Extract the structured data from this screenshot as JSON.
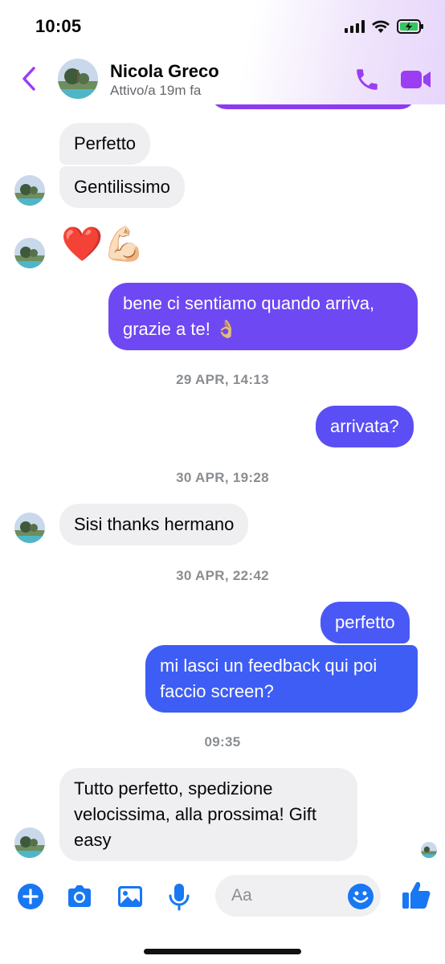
{
  "status_bar": {
    "time": "10:05"
  },
  "header": {
    "contact_name": "Nicola Greco",
    "contact_status": "Attivo/a 19m fa",
    "accent_color": "#9b3df2"
  },
  "messages": [
    {
      "type": "in",
      "text": "Perfetto"
    },
    {
      "type": "in",
      "text": "Gentilissimo"
    },
    {
      "type": "in_emoji",
      "text": "❤️💪🏻"
    },
    {
      "type": "out",
      "text": "bene ci sentiamo quando arriva, grazie a te! 👌🏼"
    },
    {
      "type": "timestamp",
      "text": "29 APR, 14:13"
    },
    {
      "type": "out",
      "text": "arrivata?"
    },
    {
      "type": "timestamp",
      "text": "30 APR, 19:28"
    },
    {
      "type": "in",
      "text": "Sisi thanks hermano"
    },
    {
      "type": "timestamp",
      "text": "30 APR, 22:42"
    },
    {
      "type": "out",
      "text": "perfetto"
    },
    {
      "type": "out",
      "text": "mi lasci un feedback qui poi faccio screen?"
    },
    {
      "type": "timestamp",
      "text": "09:35"
    },
    {
      "type": "in",
      "text": "Tutto perfetto, spedizione velocissima, alla prossima! Gift easy"
    }
  ],
  "composer": {
    "placeholder": "Aa",
    "value": ""
  },
  "colors": {
    "outgoing_top": "#8b3cf0",
    "outgoing_mid": "#6a4df4",
    "outgoing_bottom": "#3b5ef5",
    "incoming": "#efeff1",
    "icon_blue": "#1877f2"
  },
  "icons": {
    "back": "chevron-left-icon",
    "call": "phone-icon",
    "video": "video-camera-icon",
    "add": "plus-circle-icon",
    "camera": "camera-icon",
    "gallery": "image-icon",
    "mic": "microphone-icon",
    "emoji": "smiley-icon",
    "like": "thumbs-up-icon"
  }
}
